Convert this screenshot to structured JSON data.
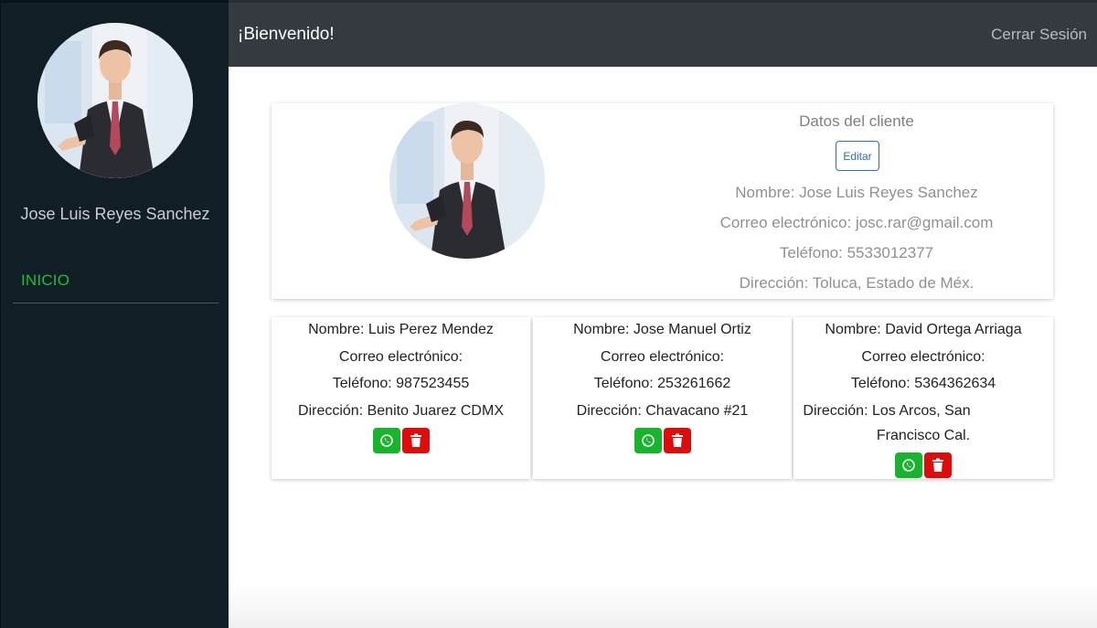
{
  "sidebar": {
    "user_name": "Jose Luis Reyes Sanchez",
    "nav_items": [
      {
        "label": "INICIO"
      }
    ]
  },
  "header": {
    "welcome": "¡Bienvenido!",
    "logout": "Cerrar Sesión"
  },
  "client": {
    "title": "Datos del cliente",
    "edit_label": "Editar",
    "name_line": "Nombre: Jose Luis Reyes Sanchez",
    "email_line": "Correo electrónico: josc.rar@gmail.com",
    "phone_line": "Teléfono: 5533012377",
    "address_line": "Dirección: Toluca, Estado de Méx."
  },
  "contacts": [
    {
      "name_line": "Nombre: Luis Perez Mendez",
      "email_line": "Correo electrónico:",
      "phone_line": "Teléfono: 987523455",
      "address_line": "Dirección: Benito Juarez CDMX"
    },
    {
      "name_line": "Nombre: Jose Manuel Ortiz",
      "email_line": "Correo electrónico:",
      "phone_line": "Teléfono: 253261662",
      "address_line": "Dirección: Chavacano #21"
    },
    {
      "name_line": "Nombre: David Ortega Arriaga",
      "email_line": "Correo electrónico:",
      "phone_line": "Teléfono: 5364362634",
      "address_line_1": "Dirección: Los Arcos, San",
      "address_line_2": "Francisco Cal."
    }
  ],
  "icons": {
    "whatsapp": "whatsapp-icon",
    "delete": "trash-icon"
  },
  "colors": {
    "sidebar_bg": "#121e25",
    "topbar_bg": "#343a40",
    "accent_green": "#1fbf3a",
    "whatsapp_green": "#16b52c",
    "delete_red": "#e00c0c",
    "edit_blue": "#2f6fb0"
  }
}
